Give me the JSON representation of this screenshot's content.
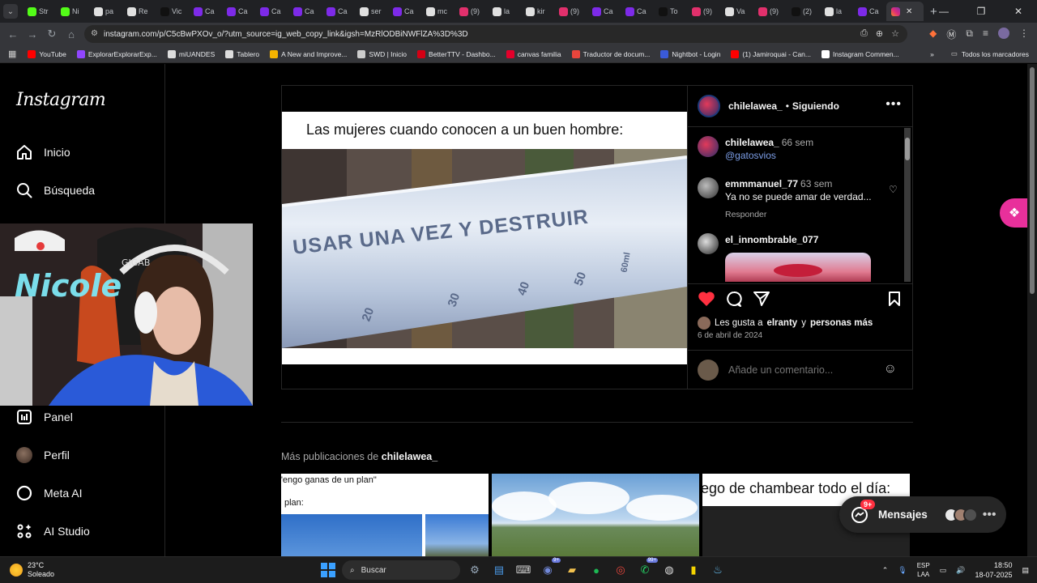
{
  "browser": {
    "tabs": [
      {
        "label": "Str",
        "color": "#53fc18"
      },
      {
        "label": "Ni",
        "color": "#53fc18"
      },
      {
        "label": "pa",
        "color": "#e0e0e0"
      },
      {
        "label": "Re",
        "color": "#e0e0e0"
      },
      {
        "label": "Vic",
        "color": "#111111"
      },
      {
        "label": "Ca",
        "color": "#7d2ae8"
      },
      {
        "label": "Ca",
        "color": "#7d2ae8"
      },
      {
        "label": "Ca",
        "color": "#7d2ae8"
      },
      {
        "label": "Ca",
        "color": "#7d2ae8"
      },
      {
        "label": "Ca",
        "color": "#7d2ae8"
      },
      {
        "label": "ser",
        "color": "#e0e0e0"
      },
      {
        "label": "Ca",
        "color": "#7d2ae8"
      },
      {
        "label": "mc",
        "color": "#e0e0e0"
      },
      {
        "label": "(9)",
        "color": "#e1306c"
      },
      {
        "label": "la",
        "color": "#e0e0e0"
      },
      {
        "label": "kir",
        "color": "#e0e0e0"
      },
      {
        "label": "(9)",
        "color": "#e1306c"
      },
      {
        "label": "Ca",
        "color": "#7d2ae8"
      },
      {
        "label": "Ca",
        "color": "#7d2ae8"
      },
      {
        "label": "To",
        "color": "#111111"
      },
      {
        "label": "(9)",
        "color": "#e1306c"
      },
      {
        "label": "Va",
        "color": "#e0e0e0"
      },
      {
        "label": "(9)",
        "color": "#e1306c"
      },
      {
        "label": "(2)",
        "color": "#111111"
      },
      {
        "label": "la",
        "color": "#e0e0e0"
      },
      {
        "label": "Ca",
        "color": "#7d2ae8"
      }
    ],
    "new_tab_symbol": "+",
    "url": "instagram.com/p/C5cBwPXOv_o/?utm_source=ig_web_copy_link&igsh=MzRlODBiNWFlZA%3D%3D",
    "bookmarks": [
      {
        "label": "YouTube",
        "color": "#ff0000"
      },
      {
        "label": "ExplorarExplorarExp...",
        "color": "#9146ff"
      },
      {
        "label": "miUANDES",
        "color": "#dddddd"
      },
      {
        "label": "Tablero",
        "color": "#dddddd"
      },
      {
        "label": "A New and Improve...",
        "color": "#f5b400"
      },
      {
        "label": "SWD | Inicio",
        "color": "#cccccc"
      },
      {
        "label": "BetterTTV - Dashbo...",
        "color": "#d50014"
      },
      {
        "label": "canvas familia",
        "color": "#e4002b"
      },
      {
        "label": "Traductor de docum...",
        "color": "#e8453c"
      },
      {
        "label": "Nightbot - Login",
        "color": "#3a5ad8"
      },
      {
        "label": "(1) Jamiroquai - Can...",
        "color": "#ff0000"
      },
      {
        "label": "Instagram Commen...",
        "color": "#ffffff"
      }
    ],
    "all_bookmarks": "Todos los marcadores"
  },
  "sidebar": {
    "logo": "Instagram",
    "items_top": [
      {
        "label": "Inicio",
        "icon": "home-icon"
      },
      {
        "label": "Búsqueda",
        "icon": "search-icon"
      }
    ],
    "items_bottom": [
      {
        "label": "Panel",
        "icon": "dashboard-icon"
      },
      {
        "label": "Perfil",
        "icon": "profile-avatar"
      },
      {
        "label": "Meta AI",
        "icon": "meta-ai-icon"
      },
      {
        "label": "AI Studio",
        "icon": "ai-studio-icon"
      }
    ]
  },
  "webcam": {
    "neon_sign": "Nicole",
    "chair_brand": "GIGAB"
  },
  "post": {
    "caption_top": "Las mujeres cuando conocen a un buen hombre:",
    "syringe_text": "USAR UNA VEZ Y DESTRUIR",
    "syringe_marks": [
      "20",
      "30",
      "40",
      "50",
      "60ml"
    ],
    "author": "chilelawea_",
    "separator": "•",
    "follow_state": "Siguiendo",
    "comments": [
      {
        "user": "chilelawea_",
        "time": "66 sem",
        "text": "@gatosvios",
        "link": true
      },
      {
        "user": "emmmanuel_77",
        "time": "63 sem",
        "text": "Ya no se puede amar de verdad...",
        "reply": "Responder"
      },
      {
        "user": "el_innombrable_077",
        "time": "",
        "text": ""
      }
    ],
    "likes_prefix": "Les gusta a",
    "likes_user": "elranty",
    "likes_join": "y",
    "likes_suffix": "personas más",
    "date": "6 de abril de 2024",
    "comment_placeholder": "Añade un comentario..."
  },
  "more": {
    "prefix": "Más publicaciones de",
    "user": "chilelawea_",
    "thumbs": [
      {
        "line1": "\"engo ganas de un plan\"",
        "line2": "plan:"
      },
      {
        "line1": ""
      },
      {
        "line1": "ego de chambear todo el día:"
      }
    ]
  },
  "messages": {
    "label": "Mensajes",
    "badge": "9+"
  },
  "taskbar": {
    "temp": "23°C",
    "weather": "Soleado",
    "search": "Buscar",
    "lang1": "ESP",
    "lang2": "LAA",
    "time": "18:50",
    "date": "18-07-2025",
    "badge_app1": "9+",
    "badge_app2": "99+"
  },
  "colors": {
    "like_red": "#ff3040",
    "link_blue": "#7d9fe8",
    "accent_pink": "#e8309b"
  }
}
